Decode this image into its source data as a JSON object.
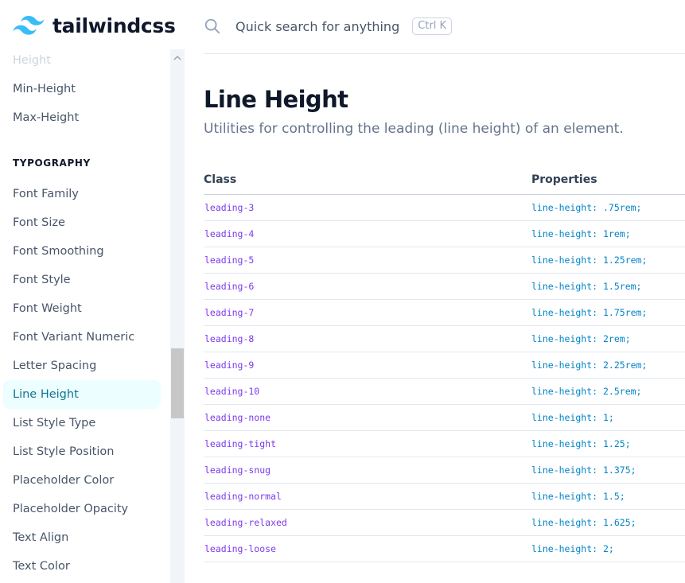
{
  "header": {
    "logo_text": "tailwindcss",
    "search_placeholder": "Quick search for anything",
    "search_shortcut": "Ctrl K"
  },
  "sidebar": {
    "items_top": [
      {
        "label": "Height",
        "state": "faded"
      },
      {
        "label": "Min-Height"
      },
      {
        "label": "Max-Height"
      }
    ],
    "section": "TYPOGRAPHY",
    "items": [
      {
        "label": "Font Family"
      },
      {
        "label": "Font Size"
      },
      {
        "label": "Font Smoothing"
      },
      {
        "label": "Font Style"
      },
      {
        "label": "Font Weight"
      },
      {
        "label": "Font Variant Numeric"
      },
      {
        "label": "Letter Spacing"
      },
      {
        "label": "Line Height",
        "active": true
      },
      {
        "label": "List Style Type"
      },
      {
        "label": "List Style Position"
      },
      {
        "label": "Placeholder Color"
      },
      {
        "label": "Placeholder Opacity"
      },
      {
        "label": "Text Align"
      },
      {
        "label": "Text Color"
      }
    ]
  },
  "main": {
    "title": "Line Height",
    "subtitle": "Utilities for controlling the leading (line height) of an element.",
    "table": {
      "col_class": "Class",
      "col_properties": "Properties",
      "rows": [
        {
          "cls": "leading-3",
          "prop": "line-height: .75rem;"
        },
        {
          "cls": "leading-4",
          "prop": "line-height: 1rem;"
        },
        {
          "cls": "leading-5",
          "prop": "line-height: 1.25rem;"
        },
        {
          "cls": "leading-6",
          "prop": "line-height: 1.5rem;"
        },
        {
          "cls": "leading-7",
          "prop": "line-height: 1.75rem;"
        },
        {
          "cls": "leading-8",
          "prop": "line-height: 2rem;"
        },
        {
          "cls": "leading-9",
          "prop": "line-height: 2.25rem;"
        },
        {
          "cls": "leading-10",
          "prop": "line-height: 2.5rem;"
        },
        {
          "cls": "leading-none",
          "prop": "line-height: 1;"
        },
        {
          "cls": "leading-tight",
          "prop": "line-height: 1.25;"
        },
        {
          "cls": "leading-snug",
          "prop": "line-height: 1.375;"
        },
        {
          "cls": "leading-normal",
          "prop": "line-height: 1.5;"
        },
        {
          "cls": "leading-relaxed",
          "prop": "line-height: 1.625;"
        },
        {
          "cls": "leading-loose",
          "prop": "line-height: 2;"
        }
      ]
    }
  },
  "colors": {
    "accent": "#38bdf8",
    "active_bg": "#ecfeff",
    "active_text": "#0e7490",
    "class_text": "#7c3aed",
    "prop_text": "#0284c7"
  },
  "icons": [
    "tailwind-logo-icon",
    "search-icon",
    "chevron-up-icon"
  ]
}
